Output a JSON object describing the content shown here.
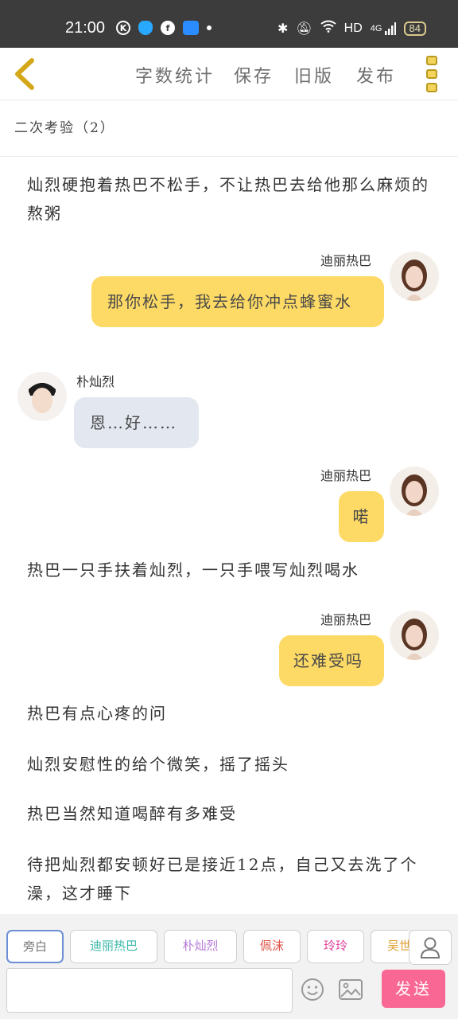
{
  "status_bar": {
    "time": "21:00",
    "network": "HD",
    "signal_type": "4G",
    "battery": "84"
  },
  "toolbar": {
    "word_count": "字数统计",
    "save": "保存",
    "old_version": "旧版",
    "publish": "发布"
  },
  "chapter_title": "二次考验（2）",
  "messages": [
    {
      "type": "narration",
      "text": "灿烈硬抱着热巴不松手，不让热巴去给他那么麻烦的熬粥"
    },
    {
      "type": "right",
      "speaker": "迪丽热巴",
      "text": "那你松手，我去给你冲点蜂蜜水"
    },
    {
      "type": "left",
      "speaker": "朴灿烈",
      "text": "恩…好……"
    },
    {
      "type": "right",
      "speaker": "迪丽热巴",
      "text": "喏"
    },
    {
      "type": "narration",
      "text": "热巴一只手扶着灿烈，一只手喂写灿烈喝水"
    },
    {
      "type": "right",
      "speaker": "迪丽热巴",
      "text": "还难受吗"
    },
    {
      "type": "narration",
      "text": "热巴有点心疼的问"
    },
    {
      "type": "narration",
      "text": "灿烈安慰性的给个微笑，摇了摇头"
    },
    {
      "type": "narration",
      "text": "热巴当然知道喝醉有多难受"
    },
    {
      "type": "narration",
      "text": "待把灿烈都安顿好已是接近12点，自己又去洗了个澡，这才睡下"
    }
  ],
  "roles": [
    {
      "label": "旁白",
      "color": "#777777"
    },
    {
      "label": "迪丽热巴",
      "color": "#3bb8a8"
    },
    {
      "label": "朴灿烈",
      "color": "#b57ad6"
    },
    {
      "label": "佩沫",
      "color": "#e0554a"
    },
    {
      "label": "玲玲",
      "color": "#e0409a"
    },
    {
      "label": "吴世",
      "color": "#e0a030"
    }
  ],
  "send_label": "发送",
  "colors": {
    "accent_yellow": "#fdd965",
    "bubble_blue": "#e3e8f0",
    "send_pink": "#f96895",
    "back_arrow": "#d4a718"
  }
}
